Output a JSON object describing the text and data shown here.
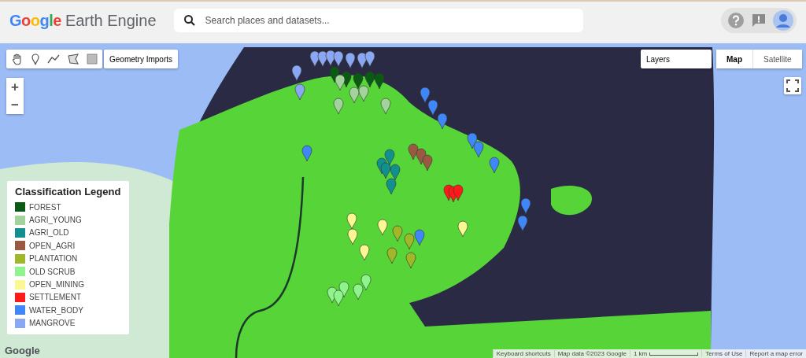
{
  "header": {
    "logo": {
      "brand": "Google",
      "product": "Earth Engine"
    },
    "search": {
      "placeholder": "Search places and datasets..."
    }
  },
  "map": {
    "geometry_imports": "Geometry Imports",
    "layers": "Layers",
    "map_types": [
      {
        "label": "Map",
        "selected": true
      },
      {
        "label": "Satellite",
        "selected": false
      }
    ],
    "zoom": [
      "+",
      "−"
    ],
    "legend": {
      "title": "Classification Legend",
      "items": [
        {
          "label": "FOREST",
          "color": "#0b5a14"
        },
        {
          "label": "AGRI_YOUNG",
          "color": "#a3d39c"
        },
        {
          "label": "AGRI_OLD",
          "color": "#128f8f"
        },
        {
          "label": "OPEN_AGRI",
          "color": "#9a5a42"
        },
        {
          "label": "PLANTATION",
          "color": "#a0b72a"
        },
        {
          "label": "OLD SCRUB",
          "color": "#8ef58c"
        },
        {
          "label": "OPEN_MINING",
          "color": "#fbf793"
        },
        {
          "label": "SETTLEMENT",
          "color": "#ff1a1a"
        },
        {
          "label": "WATER_BODY",
          "color": "#3f86f7"
        },
        {
          "label": "MANGROVE",
          "color": "#8aa7f3"
        }
      ]
    },
    "attribution": "Google",
    "footer": {
      "shortcuts": "Keyboard shortcuts",
      "map_data": "Map data ©2023 Google",
      "scale": "1 km",
      "terms": "Terms of Use",
      "report": "Report a map error"
    }
  }
}
